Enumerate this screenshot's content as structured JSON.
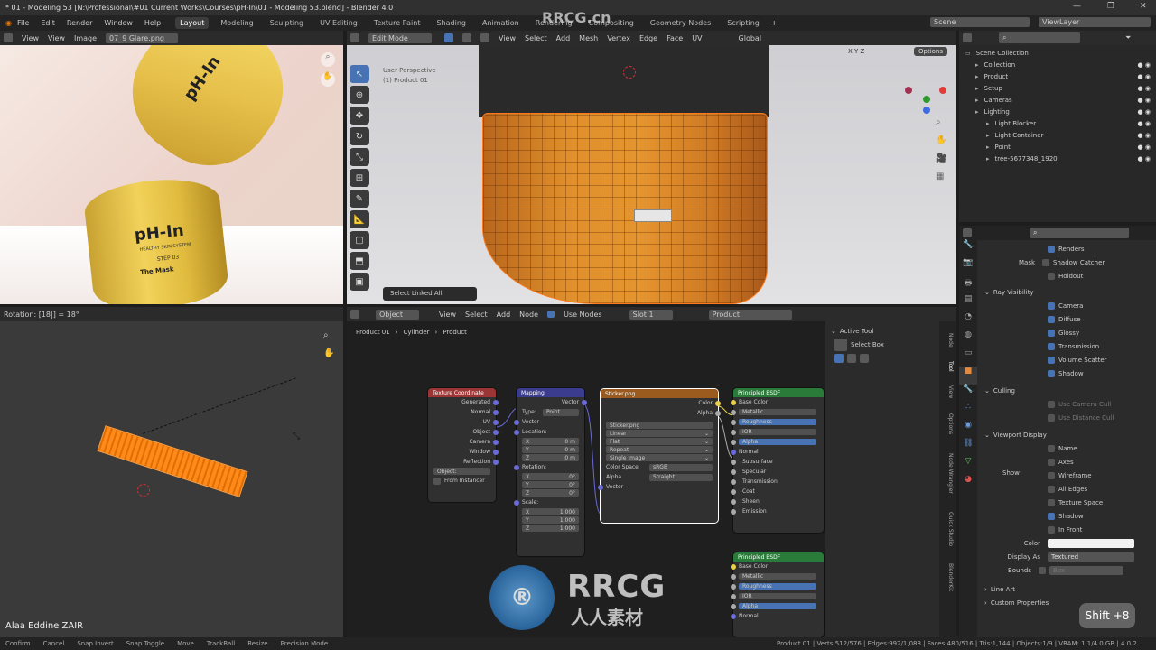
{
  "window": {
    "title": "* 01 - Modeling 53 [N:\\Professional\\#01 Current Works\\Courses\\pH-In\\01 - Modeling 53.blend] - Blender 4.0"
  },
  "menu": [
    "File",
    "Edit",
    "Render",
    "Window",
    "Help"
  ],
  "workspaces": [
    "Layout",
    "Modeling",
    "Sculpting",
    "UV Editing",
    "Texture Paint",
    "Shading",
    "Animation",
    "Rendering",
    "Compositing",
    "Geometry Nodes",
    "Scripting"
  ],
  "scene": {
    "label": "Scene",
    "view_layer": "ViewLayer"
  },
  "image_editor": {
    "view": "View",
    "view2": "View",
    "image": "Image",
    "image_name": "07_9 Glare.png"
  },
  "viewport": {
    "mode": "Edit Mode",
    "menus": [
      "View",
      "Select",
      "Add",
      "Mesh",
      "Vertex",
      "Edge",
      "Face",
      "UV"
    ],
    "orientation": "Global",
    "info1": "User Perspective",
    "info2": "(1) Product 01",
    "options": "Options",
    "axes": [
      "X",
      "Y",
      "Z"
    ],
    "last_op": "Select Linked All"
  },
  "uv_editor": {
    "status": "Rotation: [18|] = 18°",
    "credit": "Alaa Eddine ZAIR"
  },
  "node_editor": {
    "type": "Object",
    "menus": [
      "View",
      "Select",
      "Add",
      "Node"
    ],
    "use_nodes": "Use Nodes",
    "slot": "Slot 1",
    "material": "Product",
    "breadcrumb": [
      "Product 01",
      "Cylinder",
      "Product"
    ],
    "active_tool": "Active Tool",
    "select_box": "Select Box",
    "tabs": [
      "Node",
      "Tool",
      "View",
      "Options",
      "Node Wrangler",
      "Quick Studio",
      "BlenderKit"
    ]
  },
  "nodes": {
    "texcoord": {
      "title": "Texture Coordinate",
      "outputs": [
        "Generated",
        "Normal",
        "UV",
        "Object",
        "Camera",
        "Window",
        "Reflection"
      ],
      "object_label": "Object:",
      "from_instancer": "From Instancer"
    },
    "mapping": {
      "title": "Mapping",
      "vector_out": "Vector",
      "type_label": "Type:",
      "type_value": "Point",
      "vector_in": "Vector",
      "location": "Location:",
      "rotation": "Rotation:",
      "scale": "Scale:",
      "loc": [
        [
          "X",
          "0 m"
        ],
        [
          "Y",
          "0 m"
        ],
        [
          "Z",
          "0 m"
        ]
      ],
      "rot": [
        [
          "X",
          "0°"
        ],
        [
          "Y",
          "0°"
        ],
        [
          "Z",
          "0°"
        ]
      ],
      "scl": [
        [
          "X",
          "1.000"
        ],
        [
          "Y",
          "1.000"
        ],
        [
          "Z",
          "1.000"
        ]
      ]
    },
    "image": {
      "title": "Sticker.png",
      "color": "Color",
      "alpha": "Alpha",
      "file": "Sticker.png",
      "interp": "Linear",
      "proj": "Flat",
      "ext": "Repeat",
      "source": "Single Image",
      "cs_label": "Color Space",
      "cs_value": "sRGB",
      "alpha_label": "Alpha",
      "alpha_value": "Straight",
      "vector": "Vector"
    },
    "bsdf1": {
      "title": "Principled BSDF",
      "rows": [
        "Base Color",
        "Metallic",
        "Roughness",
        "IOR",
        "Alpha",
        "Normal",
        "Subsurface",
        "Specular",
        "Transmission",
        "Coat",
        "Sheen",
        "Emission"
      ]
    },
    "bsdf2": {
      "title": "Principled BSDF",
      "rows": [
        "Base Color",
        "Metallic",
        "Roughness",
        "IOR",
        "Alpha",
        "Normal"
      ]
    }
  },
  "outliner": {
    "items": [
      {
        "label": "Scene Collection",
        "indent": 0
      },
      {
        "label": "Collection",
        "indent": 1
      },
      {
        "label": "Product",
        "indent": 1
      },
      {
        "label": "Setup",
        "indent": 1
      },
      {
        "label": "Cameras",
        "indent": 1
      },
      {
        "label": "Lighting",
        "indent": 1
      },
      {
        "label": "Light Blocker",
        "indent": 2
      },
      {
        "label": "Light Container",
        "indent": 2
      },
      {
        "label": "Point",
        "indent": 2
      },
      {
        "label": "tree-5677348_1920",
        "indent": 2
      }
    ]
  },
  "properties": {
    "renders": "Renders",
    "mask": "Mask",
    "shadow_catcher": "Shadow Catcher",
    "holdout": "Holdout",
    "ray_visibility": "Ray Visibility",
    "ray_items": [
      "Camera",
      "Diffuse",
      "Glossy",
      "Transmission",
      "Volume Scatter",
      "Shadow"
    ],
    "culling": "Culling",
    "use_camera_cull": "Use Camera Cull",
    "use_distance_cull": "Use Distance Cull",
    "viewport_display": "Viewport Display",
    "show": "Show",
    "show_items": [
      "Name",
      "Axes",
      "Wireframe",
      "All Edges",
      "Texture Space",
      "Shadow",
      "In Front"
    ],
    "color": "Color",
    "display_as": "Display As",
    "display_value": "Textured",
    "bounds": "Bounds",
    "bounds_value": "Box",
    "line_art": "Line Art",
    "custom_props": "Custom Properties"
  },
  "statusbar": {
    "items": [
      "Confirm",
      "Cancel",
      "Snap Invert",
      "Snap Toggle",
      "Move",
      "TrackBall",
      "Resize",
      "Precision Mode"
    ],
    "info": "Product 01 | Verts:512/576 | Edges:992/1,088 | Faces:480/516 | Tris:1,144 | Objects:1/9 | VRAM: 1.1/4.0 GB | 4.0.2"
  },
  "keycast": "Shift +8",
  "watermark": {
    "brand": "RRCG",
    "sub": "人人素材",
    "top": "RRCG.cn"
  },
  "product": {
    "brand": "pH-In",
    "tag": "HEALTHY SKIN SYSTEM",
    "step": "STEP 03",
    "name": "The Mask"
  },
  "colors": {
    "accent": "#4772b3",
    "orange": "#ff8a1c",
    "texcoord": "#9c3636",
    "mapping": "#3c3c8e",
    "image": "#9b5b1f",
    "bsdf": "#2a7a3a"
  }
}
